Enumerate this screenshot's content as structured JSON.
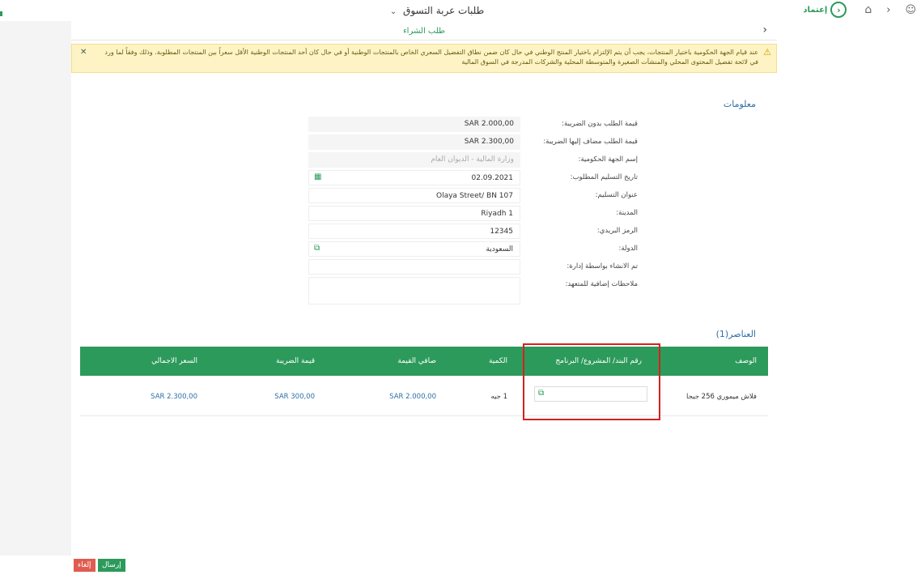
{
  "header": {
    "cart_title": "طلبات عربة التسوق",
    "brand": "إعتماد",
    "logo_glyph": "›",
    "home_icon": "home-icon",
    "user_icon": "user-icon"
  },
  "panel": {
    "title": "طلب الشراء",
    "warning": "عند قيام الجهة الحكومية باختيار المنتجات، يجب أن يتم الإلتزام باختيار المنتج الوطني في حال كان ضمن نطاق التفضيل السعري الخاص بالمنتجات الوطنية أو في حال كان أحد المنتجات الوطنية الأقل سعراً بين المنتجات المطلوبة. وذلك وفقاً لما ورد في لائحة تفضيل المحتوى المحلي والمنشآت الصغيرة والمتوسطة المحلية والشركات المدرجة في السوق المالية"
  },
  "info": {
    "section_title": "معلومات",
    "fields": [
      {
        "label": "قيمة الطلب بدون الضريبة:",
        "value": "SAR 2.000,00"
      },
      {
        "label": "قيمة الطلب مضاف إليها الضريبة:",
        "value": "SAR 2.300,00"
      },
      {
        "label": "إسم الجهة الحكومية:",
        "value": "وزارة المالية - الديوان العام"
      },
      {
        "label": "تاريخ التسليم المطلوب:",
        "value": "02.09.2021"
      },
      {
        "label": "عنوان التسليم:",
        "value": "Olaya Street/ BN 107"
      },
      {
        "label": "المدينة:",
        "value": "Riyadh 1"
      },
      {
        "label": "الرمز البريدي:",
        "value": "12345"
      },
      {
        "label": "الدولة:",
        "value": "السعودية"
      },
      {
        "label": "تم الانشاء بواسطة إدارة:",
        "value": ""
      },
      {
        "label": "ملاحظات إضافية للمتعهد:",
        "value": ""
      }
    ]
  },
  "items": {
    "section_title": "العناصر(1)",
    "columns": {
      "description": "الوصف",
      "project_number": "رقم البند/ المشروع/ البرنامج",
      "quantity": "الكمية",
      "net_value": "صافي القيمة",
      "tax_value": "قيمة الضريبة",
      "total_price": "السعر الاجمالي"
    },
    "rows": [
      {
        "description": "فلاش ميموري 256 جيجا",
        "project_number": "",
        "quantity_num": "1",
        "quantity_unit": "جيه",
        "net_value": "SAR 2.000,00",
        "tax_value": "SAR 300,00",
        "total_price": "SAR 2.300,00"
      }
    ]
  },
  "footer": {
    "send_label": "إرسال",
    "cancel_label": "إلغاء"
  },
  "colors": {
    "brand_green": "#2c9a5a",
    "warning_bg": "#fdf3c4",
    "highlight_red": "#d81f1f",
    "cancel_red": "#e05c4f"
  }
}
